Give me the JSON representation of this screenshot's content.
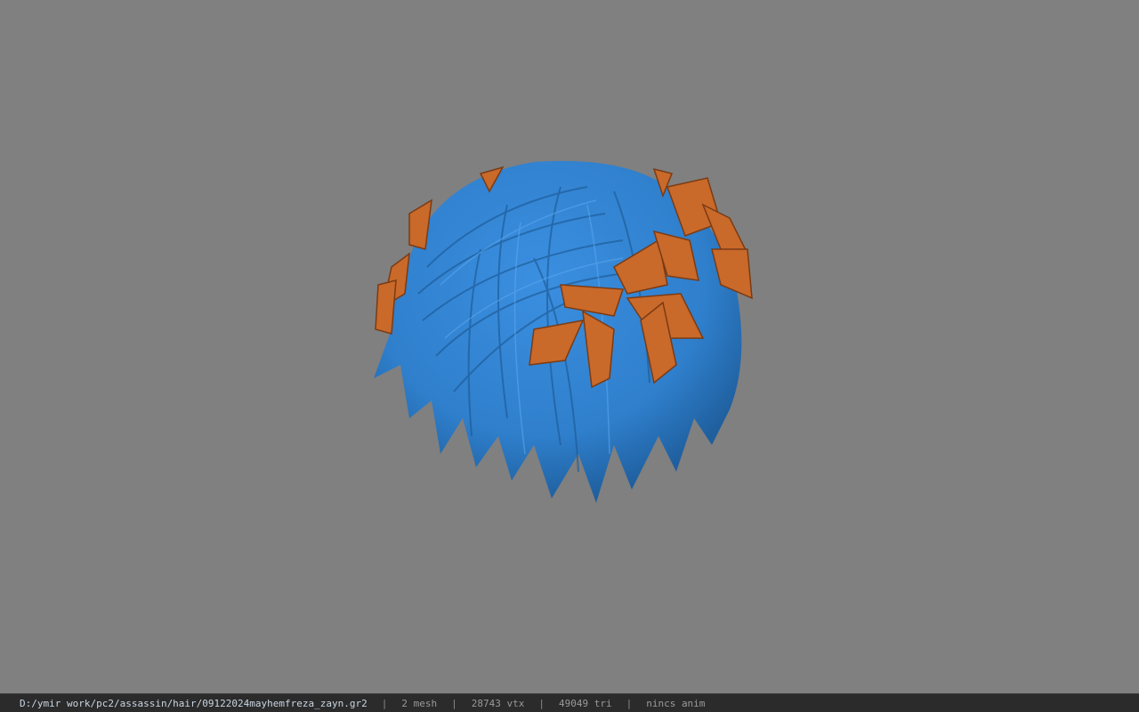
{
  "viewport": {
    "background_color": "#808080",
    "model": {
      "hair_color": "#2f7fcc",
      "leaf_color": "#c9692a"
    }
  },
  "status_bar": {
    "file_path": "D:/ymir work/pc2/assassin/hair/09122024mayhemfreza_zayn.gr2",
    "separator": "|",
    "mesh_count": "2 mesh",
    "vertex_count": "28743 vtx",
    "triangle_count": "49049 tri",
    "anim_info": "nincs anim"
  }
}
